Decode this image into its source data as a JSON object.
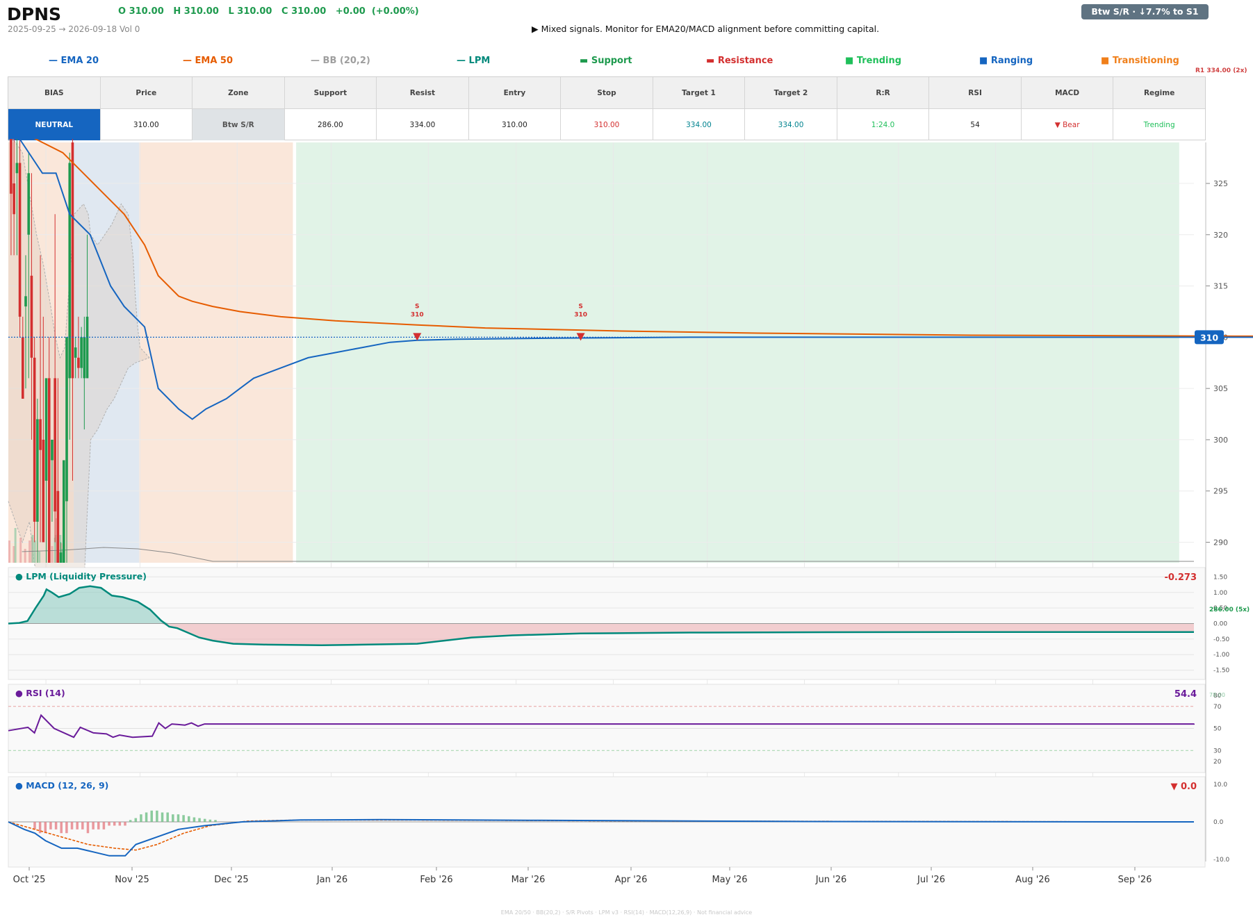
{
  "header": {
    "ticker": "DPNS",
    "ohlc": "O 310.00   H 310.00   L 310.00   C 310.00   +0.00  (+0.00%)",
    "subtitle": "2025-09-25 → 2026-09-18   Vol 0",
    "signal": "▶  Mixed signals. Monitor for EMA20/MACD alignment before committing capital.",
    "badge": "Btw S/R  ·  ↓7.7% to S1"
  },
  "legend": [
    {
      "label": "EMA 20",
      "symbol": "—",
      "color": "#1565c0"
    },
    {
      "label": "EMA 50",
      "symbol": "—",
      "color": "#e65c00"
    },
    {
      "label": "BB (20,2)",
      "symbol": "—",
      "color": "#9e9e9e"
    },
    {
      "label": "LPM",
      "symbol": "—",
      "color": "#00897b"
    },
    {
      "label": "Support",
      "symbol": "▬",
      "color": "#1e9a4e"
    },
    {
      "label": "Resistance",
      "symbol": "▬",
      "color": "#d32f2f"
    },
    {
      "label": "Trending",
      "symbol": "■",
      "color": "#1fbf5a"
    },
    {
      "label": "Ranging",
      "symbol": "■",
      "color": "#1565c0"
    },
    {
      "label": "Transitioning",
      "symbol": "■",
      "color": "#f07f1a"
    }
  ],
  "level_labels": {
    "r1": "R1 334.00 (2x)",
    "s1": "286.00 (5x)",
    "rsi_level": "78.00"
  },
  "table": {
    "headers": [
      "BIAS",
      "Price",
      "Zone",
      "Support",
      "Resist",
      "Entry",
      "Stop",
      "Target 1",
      "Target 2",
      "R:R",
      "RSI",
      "MACD",
      "Regime"
    ],
    "values": [
      "NEUTRAL",
      "310.00",
      "Btw S/R",
      "286.00",
      "334.00",
      "310.00",
      "310.00",
      "334.00",
      "334.00",
      "1:24.0",
      "54",
      "▼ Bear",
      "Trending"
    ],
    "value_colors": [
      "#ffffff",
      "#222222",
      "#555555",
      "#222222",
      "#222222",
      "#222222",
      "#d32f2f",
      "#00838f",
      "#00838f",
      "#1fbf5a",
      "#222222",
      "#d32f2f",
      "#1fbf5a"
    ]
  },
  "chart_data": {
    "type": "line",
    "x_ticks": [
      "Oct '25",
      "Nov '25",
      "Dec '25",
      "Jan '26",
      "Feb '26",
      "Mar '26",
      "Apr '26",
      "May '26",
      "Jun '26",
      "Jul '26",
      "Aug '26",
      "Sep '26"
    ],
    "price_panel": {
      "ylim": [
        288,
        329
      ],
      "y_ticks": [
        325,
        320,
        315,
        310,
        305,
        300,
        295,
        290
      ],
      "last_price": 310,
      "last_price_label": "310",
      "candles": [
        {
          "o": 330,
          "h": 331,
          "l": 318,
          "c": 324
        },
        {
          "o": 325,
          "h": 330,
          "l": 318,
          "c": 322
        },
        {
          "o": 326,
          "h": 331,
          "l": 318,
          "c": 327
        },
        {
          "o": 327,
          "h": 330,
          "l": 310,
          "c": 312
        },
        {
          "o": 310,
          "h": 312,
          "l": 304,
          "c": 304
        },
        {
          "o": 313,
          "h": 318,
          "l": 305,
          "c": 314
        },
        {
          "o": 320,
          "h": 328,
          "l": 306,
          "c": 326
        },
        {
          "o": 316,
          "h": 326,
          "l": 300,
          "c": 308
        },
        {
          "o": 308,
          "h": 310,
          "l": 290,
          "c": 292
        },
        {
          "o": 292,
          "h": 304,
          "l": 288,
          "c": 302
        },
        {
          "o": 302,
          "h": 318,
          "l": 290,
          "c": 299
        },
        {
          "o": 300,
          "h": 312,
          "l": 292,
          "c": 290
        },
        {
          "o": 296,
          "h": 304,
          "l": 288,
          "c": 306
        },
        {
          "o": 306,
          "h": 310,
          "l": 288,
          "c": 288
        },
        {
          "o": 298,
          "h": 300,
          "l": 292,
          "c": 300
        },
        {
          "o": 306,
          "h": 322,
          "l": 290,
          "c": 293
        },
        {
          "o": 295,
          "h": 306,
          "l": 285,
          "c": 285
        },
        {
          "o": 285,
          "h": 290,
          "l": 284,
          "c": 289
        },
        {
          "o": 288,
          "h": 298,
          "l": 287,
          "c": 298
        },
        {
          "o": 294,
          "h": 310,
          "l": 284,
          "c": 310
        },
        {
          "o": 306,
          "h": 328,
          "l": 300,
          "c": 327
        },
        {
          "o": 329,
          "h": 331,
          "l": 296,
          "c": 306
        },
        {
          "o": 308,
          "h": 310,
          "l": 306,
          "c": 309
        },
        {
          "o": 308,
          "h": 312,
          "l": 306,
          "c": 307
        },
        {
          "o": 307,
          "h": 311,
          "l": 306,
          "c": 310
        },
        {
          "o": 306,
          "h": 312,
          "l": 301,
          "c": 310
        },
        {
          "o": 306,
          "h": 320,
          "l": 306,
          "c": 312
        }
      ],
      "volume": [
        16,
        0,
        0,
        0,
        0,
        0,
        12,
        0,
        25,
        0,
        0,
        0,
        0,
        0,
        0,
        18,
        0,
        0,
        0,
        0,
        0,
        10,
        0,
        0,
        0,
        0,
        0,
        16,
        0,
        0,
        18,
        20,
        0,
        0,
        16,
        0,
        0,
        0,
        0,
        0,
        8,
        0,
        0,
        0,
        0,
        0,
        0,
        0,
        0,
        0,
        0,
        0,
        0,
        0,
        0,
        0,
        0,
        12,
        0,
        0,
        0,
        18,
        20,
        32,
        0,
        0,
        0,
        0,
        20,
        14,
        10
      ],
      "ema20": [
        [
          0,
          331
        ],
        [
          10,
          329
        ],
        [
          25,
          326
        ],
        [
          35,
          326
        ],
        [
          45,
          322
        ],
        [
          60,
          320
        ],
        [
          75,
          315
        ],
        [
          85,
          313
        ],
        [
          100,
          311
        ],
        [
          110,
          305
        ],
        [
          125,
          303
        ],
        [
          135,
          302
        ],
        [
          145,
          303
        ],
        [
          160,
          304
        ],
        [
          170,
          305
        ],
        [
          180,
          306
        ],
        [
          200,
          307
        ],
        [
          220,
          308
        ],
        [
          240,
          308.5
        ],
        [
          260,
          309
        ],
        [
          280,
          309.5
        ],
        [
          300,
          309.7
        ],
        [
          330,
          309.8
        ],
        [
          400,
          309.9
        ],
        [
          500,
          310
        ],
        [
          1720,
          310
        ]
      ],
      "ema50": [
        [
          0,
          331
        ],
        [
          10,
          330
        ],
        [
          25,
          329
        ],
        [
          40,
          328
        ],
        [
          55,
          326
        ],
        [
          70,
          324
        ],
        [
          85,
          322
        ],
        [
          100,
          319
        ],
        [
          110,
          316
        ],
        [
          125,
          314
        ],
        [
          135,
          313.5
        ],
        [
          150,
          313
        ],
        [
          170,
          312.5
        ],
        [
          200,
          312
        ],
        [
          240,
          311.6
        ],
        [
          300,
          311.2
        ],
        [
          350,
          310.9
        ],
        [
          450,
          310.6
        ],
        [
          550,
          310.4
        ],
        [
          700,
          310.2
        ],
        [
          900,
          310.1
        ],
        [
          1200,
          310.05
        ],
        [
          1720,
          310
        ]
      ],
      "bb_upper": [
        [
          0,
          330
        ],
        [
          30,
          328
        ],
        [
          45,
          324
        ],
        [
          60,
          320
        ],
        [
          75,
          317
        ],
        [
          90,
          313
        ],
        [
          100,
          310
        ],
        [
          110,
          308
        ],
        [
          120,
          309
        ],
        [
          140,
          322
        ],
        [
          160,
          323
        ],
        [
          170,
          322
        ],
        [
          175,
          320
        ],
        [
          190,
          319
        ],
        [
          205,
          320
        ],
        [
          220,
          321
        ],
        [
          240,
          323
        ],
        [
          255,
          322
        ],
        [
          265,
          318
        ],
        [
          270,
          314
        ],
        [
          275,
          311
        ],
        [
          280,
          309
        ],
        [
          290,
          308.5
        ],
        [
          300,
          308
        ]
      ],
      "bb_lower": [
        [
          0,
          294
        ],
        [
          30,
          290
        ],
        [
          45,
          292
        ],
        [
          55,
          288
        ],
        [
          70,
          285
        ],
        [
          100,
          282
        ],
        [
          130,
          280
        ],
        [
          160,
          285
        ],
        [
          175,
          300
        ],
        [
          190,
          301
        ],
        [
          200,
          302
        ],
        [
          210,
          303
        ],
        [
          225,
          304
        ],
        [
          235,
          305
        ],
        [
          245,
          306
        ],
        [
          255,
          307
        ],
        [
          270,
          307.5
        ],
        [
          300,
          308
        ]
      ],
      "sr_markers": [
        {
          "day": 75,
          "label1": "S",
          "label2": "310"
        },
        {
          "day": 105,
          "label1": "S",
          "label2": "310"
        }
      ],
      "regimes": [
        {
          "start": 0,
          "end": 20,
          "type": "transitioning"
        },
        {
          "start": 20,
          "end": 40,
          "type": "ranging"
        },
        {
          "start": 40,
          "end": 87,
          "type": "transitioning"
        },
        {
          "start": 88,
          "end": 358,
          "type": "trending"
        }
      ]
    },
    "lpm_panel": {
      "title": "LPM (Liquidity Pressure)",
      "last_value": "-0.273",
      "ylim": [
        -1.8,
        1.8
      ],
      "y_ticks": [
        "1.50",
        "1.00",
        "0.50",
        "0.00",
        "-0.50",
        "-1.00",
        "-1.50"
      ],
      "values": [
        [
          0,
          0
        ],
        [
          8,
          0.02
        ],
        [
          14,
          0.08
        ],
        [
          20,
          0.5
        ],
        [
          26,
          0.9
        ],
        [
          28,
          1.1
        ],
        [
          32,
          1.0
        ],
        [
          37,
          0.85
        ],
        [
          45,
          0.95
        ],
        [
          52,
          1.15
        ],
        [
          60,
          1.2
        ],
        [
          68,
          1.15
        ],
        [
          76,
          0.9
        ],
        [
          84,
          0.85
        ],
        [
          95,
          0.7
        ],
        [
          104,
          0.45
        ],
        [
          112,
          0.1
        ],
        [
          118,
          -0.1
        ],
        [
          124,
          -0.15
        ],
        [
          132,
          -0.3
        ],
        [
          140,
          -0.45
        ],
        [
          150,
          -0.55
        ],
        [
          165,
          -0.65
        ],
        [
          190,
          -0.68
        ],
        [
          230,
          -0.7
        ],
        [
          260,
          -0.68
        ],
        [
          300,
          -0.65
        ],
        [
          320,
          -0.55
        ],
        [
          340,
          -0.45
        ],
        [
          370,
          -0.38
        ],
        [
          420,
          -0.32
        ],
        [
          500,
          -0.29
        ],
        [
          600,
          -0.28
        ],
        [
          700,
          -0.275
        ],
        [
          870,
          -0.273
        ]
      ]
    },
    "rsi_panel": {
      "title": "RSI (14)",
      "last_value": "54.4",
      "ylim": [
        10,
        90
      ],
      "y_ticks": [
        80,
        70,
        50,
        30,
        20
      ],
      "values": [
        [
          0,
          48
        ],
        [
          6,
          51
        ],
        [
          8,
          46
        ],
        [
          10,
          62
        ],
        [
          14,
          50
        ],
        [
          20,
          42
        ],
        [
          22,
          51
        ],
        [
          26,
          46
        ],
        [
          30,
          45
        ],
        [
          32,
          42
        ],
        [
          34,
          44
        ],
        [
          38,
          42
        ],
        [
          44,
          43
        ],
        [
          46,
          55
        ],
        [
          48,
          50
        ],
        [
          50,
          54
        ],
        [
          54,
          53
        ],
        [
          56,
          55
        ],
        [
          58,
          52
        ],
        [
          60,
          54
        ],
        [
          400,
          54
        ],
        [
          870,
          54.4
        ]
      ]
    },
    "macd_panel": {
      "title": "MACD (12, 26, 9)",
      "last_value": "▼ 0.0",
      "ylim": [
        -12,
        12
      ],
      "y_ticks": [
        "10.0",
        "0.0",
        "-10.0"
      ],
      "macd": [
        [
          0,
          0
        ],
        [
          6,
          -2
        ],
        [
          10,
          -3
        ],
        [
          14,
          -5
        ],
        [
          20,
          -7
        ],
        [
          26,
          -7
        ],
        [
          32,
          -8
        ],
        [
          38,
          -9
        ],
        [
          44,
          -9
        ],
        [
          48,
          -6
        ],
        [
          56,
          -4
        ],
        [
          64,
          -2
        ],
        [
          74,
          -1
        ],
        [
          88,
          0
        ],
        [
          110,
          0.5
        ],
        [
          140,
          0.6
        ],
        [
          200,
          0.4
        ],
        [
          300,
          0.1
        ],
        [
          870,
          0
        ]
      ],
      "signal": [
        [
          0,
          0
        ],
        [
          10,
          -2
        ],
        [
          20,
          -4
        ],
        [
          30,
          -6
        ],
        [
          40,
          -7
        ],
        [
          48,
          -7.5
        ],
        [
          56,
          -6
        ],
        [
          66,
          -3
        ],
        [
          76,
          -1
        ],
        [
          90,
          0.2
        ],
        [
          110,
          0.5
        ],
        [
          150,
          0.5
        ],
        [
          250,
          0.2
        ],
        [
          870,
          0
        ]
      ],
      "hist": [
        [
          10,
          -2
        ],
        [
          12,
          -3
        ],
        [
          14,
          -3
        ],
        [
          16,
          -2
        ],
        [
          18,
          -2
        ],
        [
          20,
          -3
        ],
        [
          22,
          -3
        ],
        [
          24,
          -2
        ],
        [
          26,
          -2
        ],
        [
          28,
          -2
        ],
        [
          30,
          -3
        ],
        [
          32,
          -2
        ],
        [
          34,
          -2
        ],
        [
          36,
          -2
        ],
        [
          38,
          -1
        ],
        [
          40,
          -1
        ],
        [
          42,
          -1
        ],
        [
          44,
          -1
        ],
        [
          46,
          0.5
        ],
        [
          48,
          1
        ],
        [
          50,
          2
        ],
        [
          52,
          2.5
        ],
        [
          54,
          3
        ],
        [
          56,
          3
        ],
        [
          58,
          2.5
        ],
        [
          60,
          2.5
        ],
        [
          62,
          2
        ],
        [
          64,
          2
        ],
        [
          66,
          1.8
        ],
        [
          68,
          1.5
        ],
        [
          70,
          1.2
        ],
        [
          72,
          1
        ],
        [
          74,
          0.8
        ],
        [
          76,
          0.6
        ],
        [
          78,
          0.5
        ]
      ]
    }
  },
  "footer": "EMA 20/50  ·  BB(20,2)  ·  S/R Pivots  ·  LPM v3  ·  RSI(14)  ·  MACD(12,26,9)  ·  Not financial advice"
}
